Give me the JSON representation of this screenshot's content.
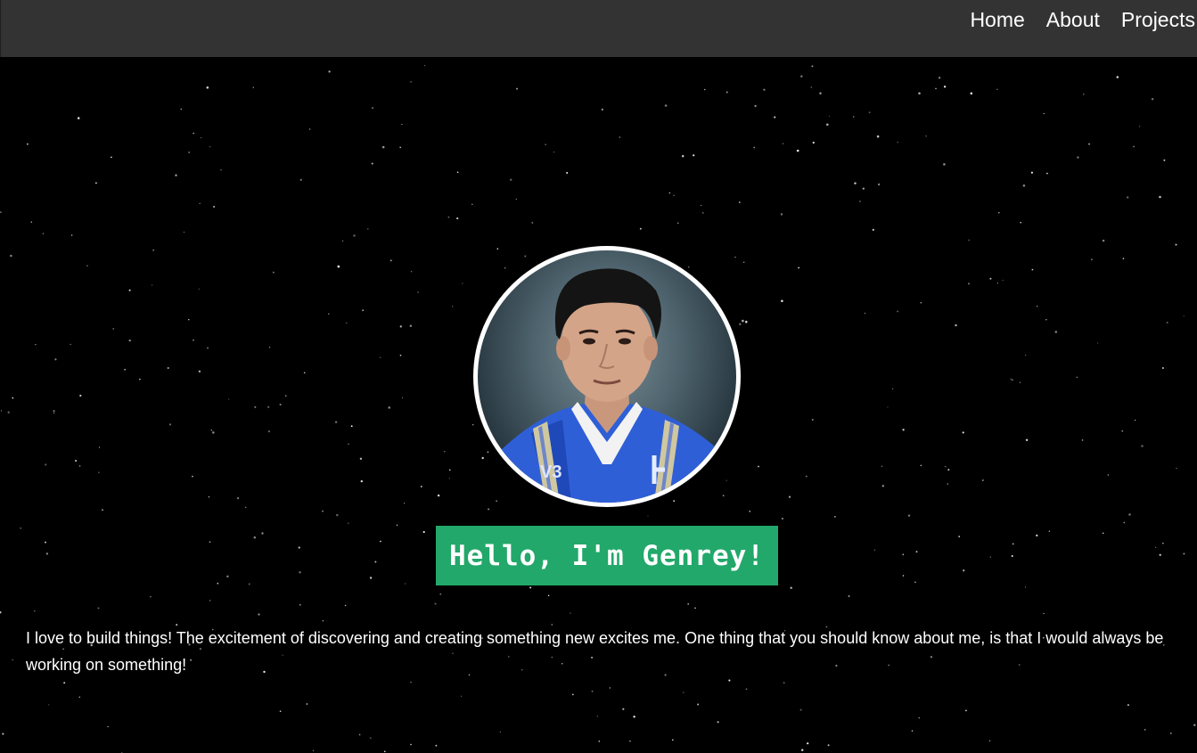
{
  "nav": {
    "items": [
      {
        "label": "Home"
      },
      {
        "label": "About"
      },
      {
        "label": "Projects"
      }
    ]
  },
  "hero": {
    "avatar_alt": "Profile photo of Genrey in graduation attire",
    "greeting": "Hello, I'm Genrey!",
    "bio": "I love to build things! The excitement of discovering and creating something new excites me. One thing that you should know about me, is that I would always be working on something!"
  },
  "colors": {
    "navbar_bg": "#333333",
    "page_bg": "#000000",
    "greeting_bg": "#22a86a",
    "text": "#ffffff"
  }
}
